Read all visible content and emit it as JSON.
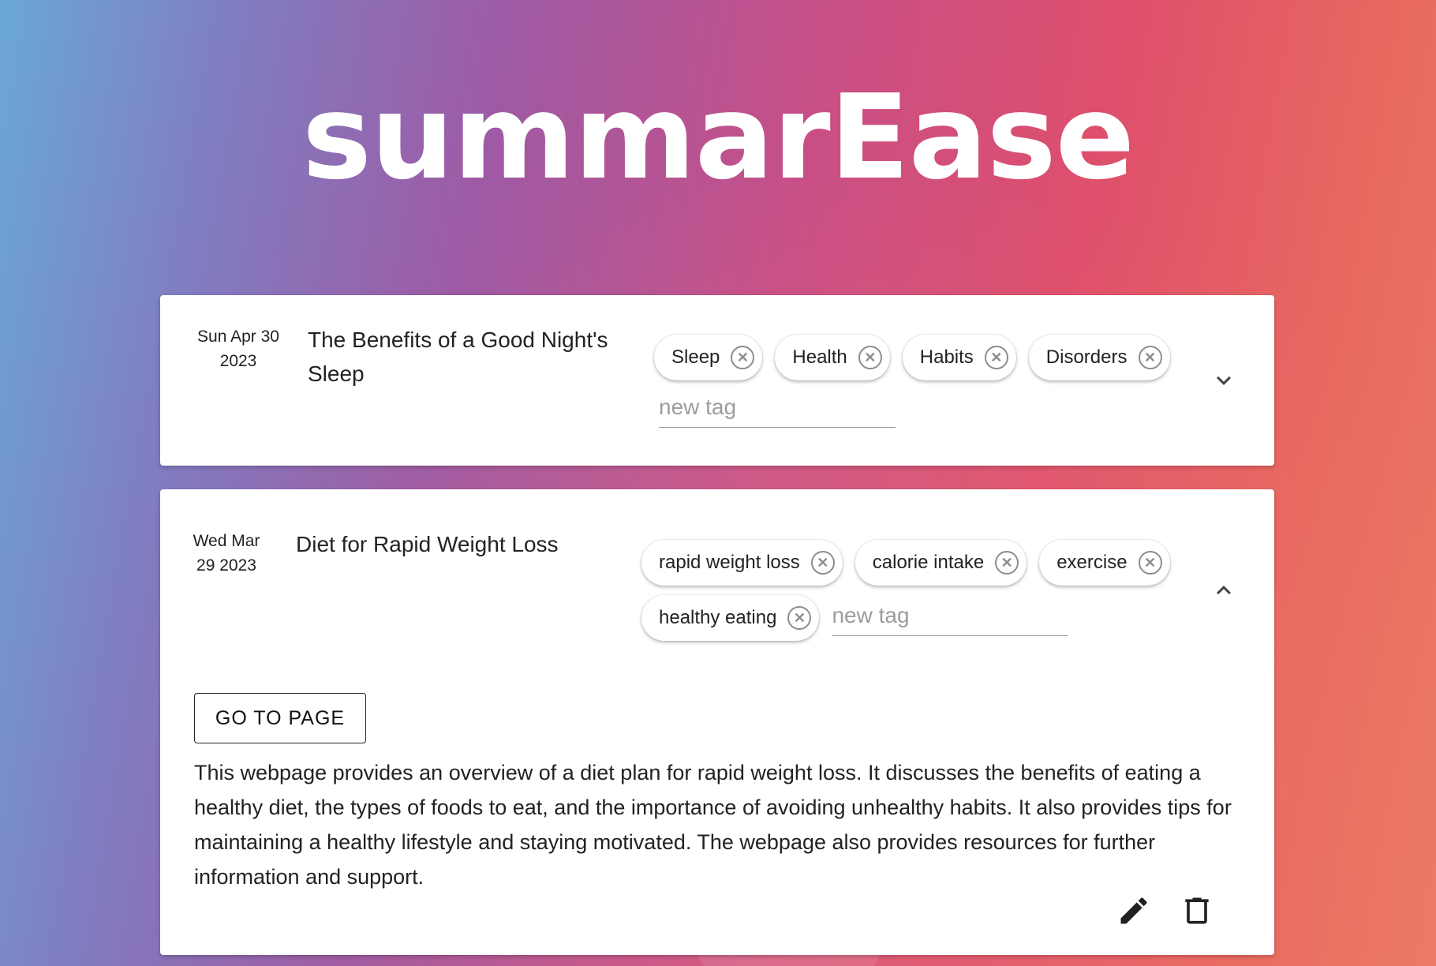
{
  "app": {
    "title": "summarEase"
  },
  "entries": [
    {
      "date_line1": "Sun Apr 30",
      "date_line2": "2023",
      "title": "The Benefits of a Good Night's Sleep",
      "tags": [
        "Sleep",
        "Health",
        "Habits",
        "Disorders"
      ],
      "new_tag_placeholder": "new tag",
      "expand_icon": "chevron-down-icon"
    },
    {
      "date_line1": "Wed Mar",
      "date_line2": "29 2023",
      "title": "Diet for Rapid Weight Loss",
      "tags": [
        "rapid weight loss",
        "calorie intake",
        "exercise",
        "healthy eating"
      ],
      "new_tag_placeholder": "new tag",
      "collapse_icon": "chevron-up-icon",
      "go_to_page_label": "GO TO PAGE",
      "summary": "This webpage provides an overview of a diet plan for rapid weight loss. It discusses the benefits of eating a healthy diet, the types of foods to eat, and the importance of avoiding unhealthy habits. It also provides tips for maintaining a healthy lifestyle and staying motivated. The webpage also provides resources for further information and support.",
      "actions": [
        "pencil-icon",
        "trash-icon"
      ]
    }
  ]
}
